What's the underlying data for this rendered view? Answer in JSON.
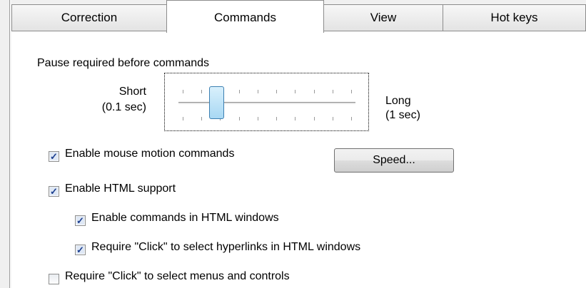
{
  "tabs": [
    {
      "label": "Correction"
    },
    {
      "label": "Commands",
      "active": true
    },
    {
      "label": "View"
    },
    {
      "label": "Hot keys"
    }
  ],
  "pause": {
    "heading": "Pause required before commands",
    "short_label": "Short",
    "short_value": "(0.1 sec)",
    "long_label": "Long",
    "long_value": "(1 sec)",
    "level_fraction": 0.2
  },
  "options": {
    "mouse_motion": {
      "label": "Enable mouse motion commands",
      "checked": true
    },
    "speed_button": "Speed...",
    "html_support": {
      "label": "Enable HTML support",
      "checked": true
    },
    "html_commands": {
      "label": "Enable commands in HTML windows",
      "checked": true
    },
    "html_click": {
      "label": "Require \"Click\" to select hyperlinks in HTML windows",
      "checked": true
    },
    "menu_click": {
      "label": "Require \"Click\" to select menus and controls",
      "checked": false
    }
  }
}
